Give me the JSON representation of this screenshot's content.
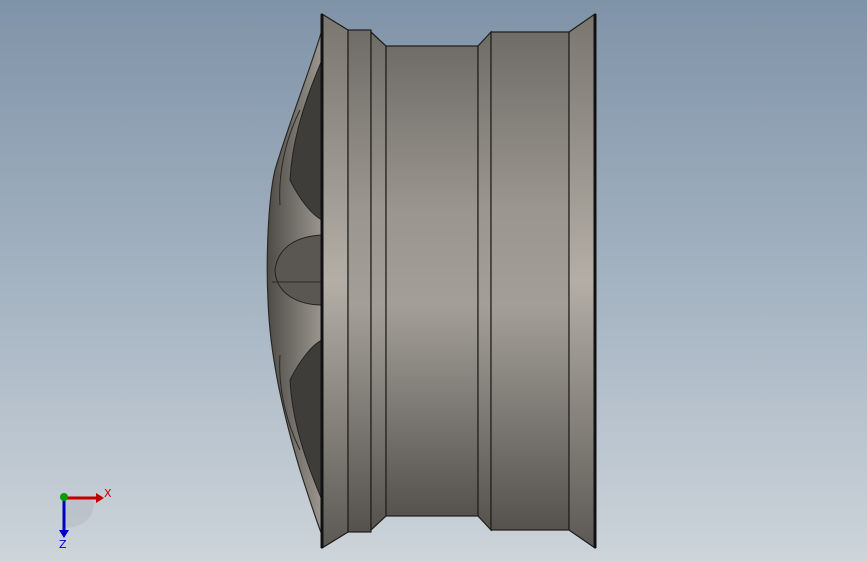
{
  "viewport": {
    "background_top": "#7f93a8",
    "background_bottom": "#cdd4da"
  },
  "model": {
    "part": "wheel-rim",
    "metal_color": "#8e8a84"
  },
  "triad": {
    "x_label": "X",
    "z_label": "Z",
    "x_color": "#c00000",
    "y_color": "#00a000",
    "z_color": "#0000c0"
  }
}
